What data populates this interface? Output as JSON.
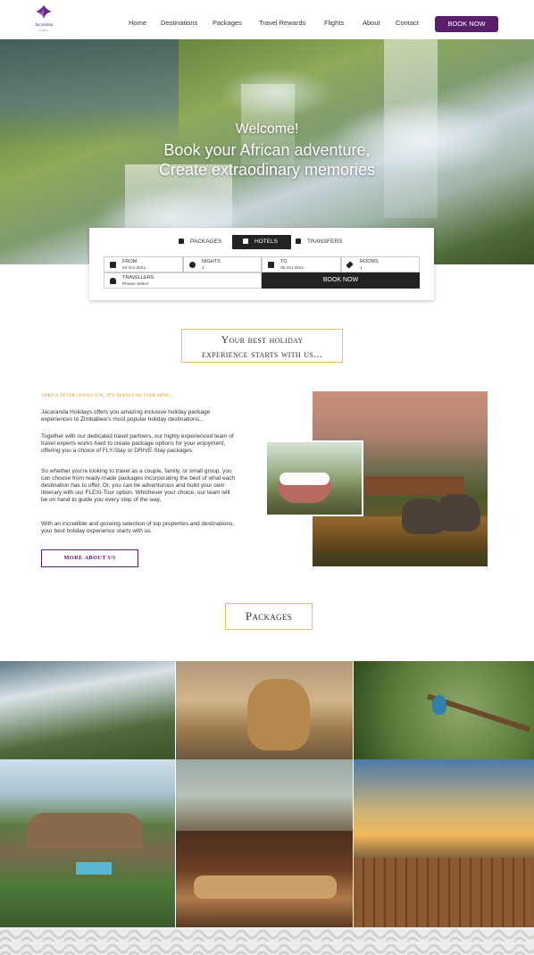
{
  "brand": {
    "name": "Jacaranda",
    "sub": "Holidays",
    "accent": "#5a1f6b",
    "gold": "#e7c069"
  },
  "nav": {
    "items": [
      "Home",
      "Destinations",
      "Packages",
      "Travel Rewards",
      "Flights",
      "About",
      "Contact"
    ],
    "book_label": "BOOK NOW"
  },
  "hero": {
    "welcome": "Welcome!",
    "line1": "Book your African adventure,",
    "line2": "Create extraodinary memories"
  },
  "booking": {
    "tabs": [
      {
        "label": "PACKAGES",
        "icon": "document-icon"
      },
      {
        "label": "HOTELS",
        "icon": "bed-icon"
      },
      {
        "label": "TRANSFERS",
        "icon": "bus-icon"
      }
    ],
    "active_tab": "HOTELS",
    "fields": {
      "from": {
        "label": "FROM",
        "value": "04 Oct 2021",
        "icon": "calendar-icon"
      },
      "nights": {
        "label": "NIGHTS",
        "value": "2",
        "icon": "moon-icon"
      },
      "to": {
        "label": "TO",
        "value": "06 Oct 2021",
        "icon": "calendar-icon"
      },
      "rooms": {
        "label": "ROOMS",
        "value": "1",
        "icon": "key-icon"
      },
      "travellers": {
        "label": "TRAVELLERS",
        "value": "Please Select",
        "icon": "person-icon"
      }
    },
    "submit": "BOOK NOW"
  },
  "intro": {
    "line1": "Your best holiday",
    "line2": "experience starts with us..."
  },
  "about": {
    "tagline": "Africa never leaves you, it's always on your mind...",
    "paragraphs": [
      "Jacaranda Holidays offers you amazing inclusive holiday package experiences to Zimbabwe's most popular holiday destinations...",
      "Together with our dedicated travel partners, our highly experienced team of travel experts works hard to create package options for your enjoyment, offering you a choice of FLY-Stay or DRIVE-Stay packages.",
      "So whether you're looking to travel as a couple, family, or small group, you can choose from ready-made packages incorporating the best of what each destination has to offer. Or, you can be adventurous and build your own itinerary with our FLEXI-Tour option. Whichever your choice, our team will be on hand to guide you every step of the way.",
      "With an incredible and growing selection of top properties and destinations, your best holiday experience starts with us."
    ],
    "button": "MORE ABOUT US"
  },
  "packages": {
    "title": "Packages"
  }
}
